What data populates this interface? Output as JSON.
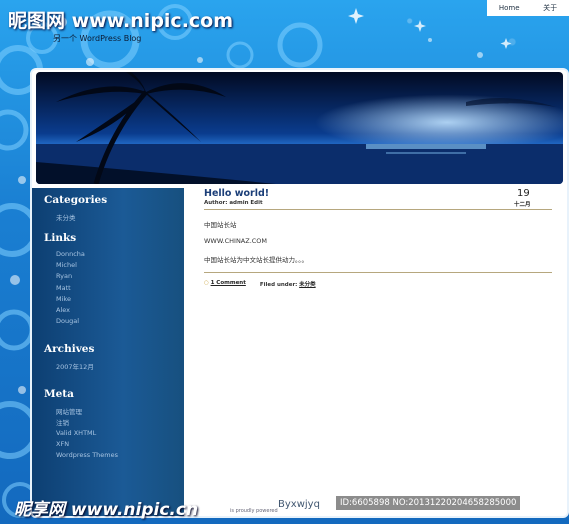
{
  "watermark": {
    "top": "昵图网 www.nipic.com",
    "bottom_left": "昵享网 www.nipic.cn",
    "bottom_mid": "Byxwjyq",
    "id_text": "ID:6605898 NO:20131220204658285000"
  },
  "site": {
    "title": "另一个 WordPress Blog"
  },
  "topnav": {
    "items": [
      "Home",
      "关于"
    ]
  },
  "sidebar": {
    "categories": {
      "title": "Categories",
      "items": [
        "未分类"
      ]
    },
    "links": {
      "title": "Links",
      "items": [
        "Donncha",
        "Michel",
        "Ryan",
        "Matt",
        "Mike",
        "Alex",
        "Dougal"
      ]
    },
    "archives": {
      "title": "Archives",
      "items": [
        "2007年12月"
      ]
    },
    "meta": {
      "title": "Meta",
      "items": [
        "网站管理",
        "注销",
        "Valid XHTML",
        "XFN",
        "Wordpress Themes"
      ]
    }
  },
  "post": {
    "title": "Hello world!",
    "meta": "Author: admin Edit",
    "date_day": "19",
    "date_month": "十二月",
    "paragraphs": [
      "中国站长站",
      "WWW.CHINAZ.COM",
      "中国站长站为中文站长提供动力。。。"
    ],
    "comments": "1 Comment",
    "filed_label": "Filed under:",
    "filed_category": "未分类"
  },
  "footer": {
    "powered": "is proudly powered"
  },
  "colors": {
    "accent": "#1a86d6",
    "sidebar": "#0d3f72",
    "title": "#1b3e78"
  }
}
